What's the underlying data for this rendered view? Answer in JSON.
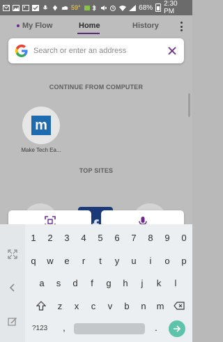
{
  "status_bar": {
    "temperature": "59°",
    "battery_percent": "68%",
    "time": "2:30 PM"
  },
  "tabs": {
    "my_flow": "My Flow",
    "home": "Home",
    "history": "History"
  },
  "address_bar": {
    "placeholder": "Search or enter an address"
  },
  "continue_section": {
    "title": "CONTINUE FROM COMPUTER",
    "items": [
      {
        "label": "Make Tech Ea...",
        "logo_letter": "m"
      }
    ]
  },
  "top_sites": {
    "title": "TOP SITES",
    "visible_letter": "f"
  },
  "keyboard": {
    "number_row": [
      "1",
      "2",
      "3",
      "4",
      "5",
      "6",
      "7",
      "8",
      "9",
      "0"
    ],
    "row1": [
      "q",
      "w",
      "e",
      "r",
      "t",
      "y",
      "u",
      "i",
      "o",
      "p"
    ],
    "row2": [
      "a",
      "s",
      "d",
      "f",
      "g",
      "h",
      "j",
      "k",
      "l"
    ],
    "row3": [
      "z",
      "x",
      "c",
      "v",
      "b",
      "n",
      "m"
    ],
    "symbols_key": "?123",
    "comma_key": ",",
    "period_key": "."
  },
  "colors": {
    "accent": "#6b2a8a",
    "enter_key": "#5fc3ab",
    "brand_blue": "#1e6bb0"
  }
}
